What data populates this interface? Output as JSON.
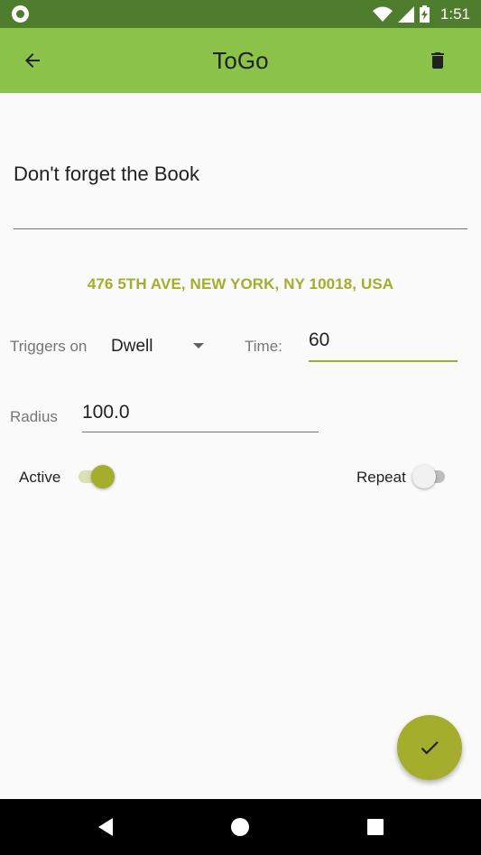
{
  "status_bar": {
    "time": "1:51",
    "icons": [
      "notification-icon",
      "wifi-icon",
      "cell-signal-icon",
      "battery-charging-icon"
    ]
  },
  "app_bar": {
    "title": "ToGo",
    "back_icon": "arrow-back-icon",
    "delete_icon": "trash-icon"
  },
  "form": {
    "title_value": "Don't forget the Book",
    "address": "476 5TH AVE, NEW YORK, NY 10018, USA",
    "triggers_label": "Triggers on",
    "trigger_value": "Dwell",
    "time_label": "Time:",
    "time_value": "60",
    "radius_label": "Radius",
    "radius_value": "100.0",
    "active_label": "Active",
    "active_on": true,
    "repeat_label": "Repeat",
    "repeat_on": false
  },
  "fab": {
    "icon": "checkmark-icon"
  },
  "nav_bar": {
    "icons": [
      "back-triangle-icon",
      "home-circle-icon",
      "recents-square-icon"
    ]
  },
  "colors": {
    "status_bar": "#4d7d2d",
    "app_bar": "#8bc34a",
    "accent": "#a4ad2c",
    "background": "#fafafa"
  }
}
